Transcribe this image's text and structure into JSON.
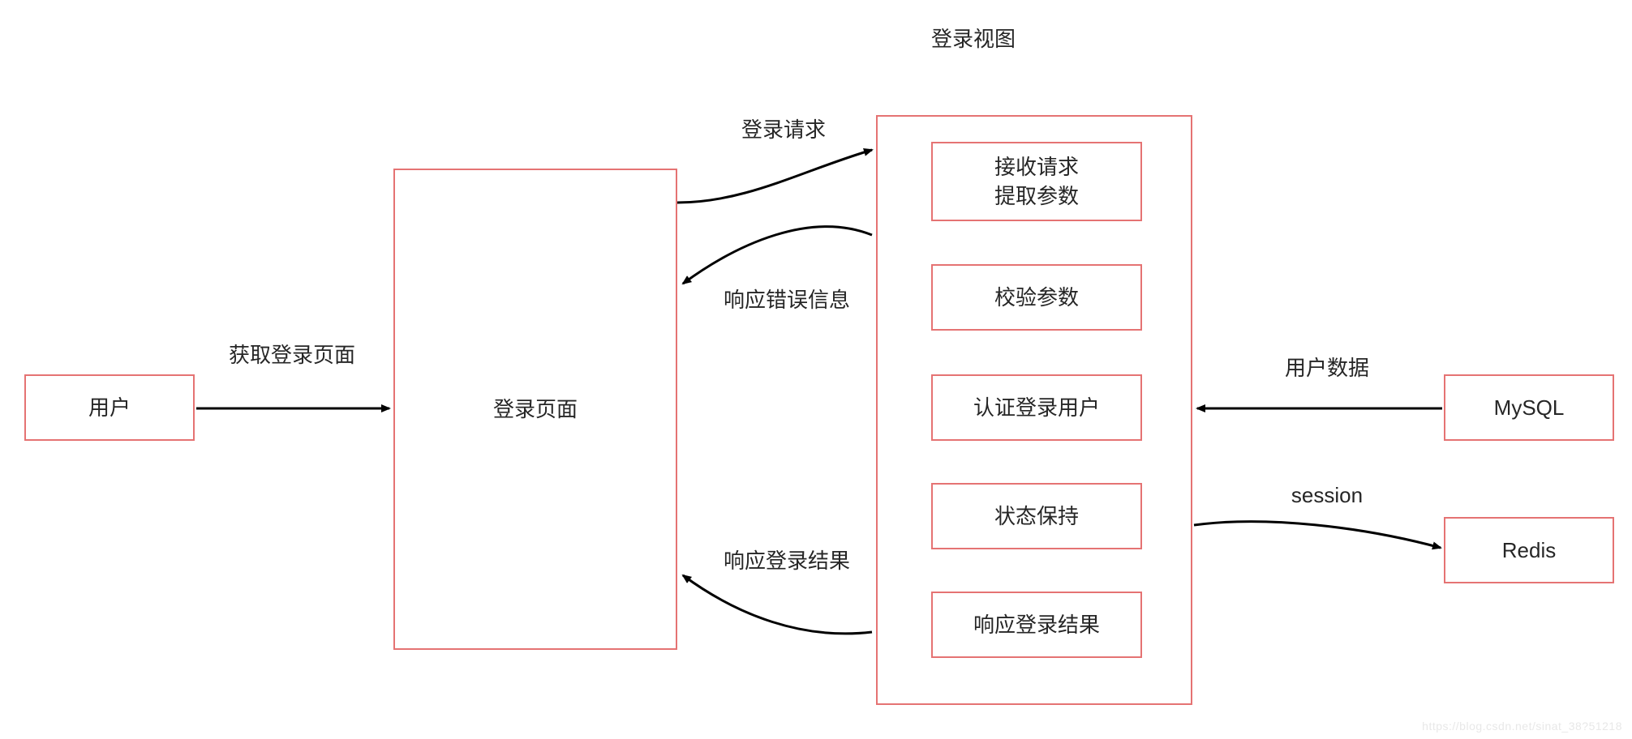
{
  "title": "登录视图",
  "nodes": {
    "user": "用户",
    "login_page": "登录页面",
    "step_receive": "接收请求\n提取参数",
    "step_validate": "校验参数",
    "step_auth": "认证登录用户",
    "step_state": "状态保持",
    "step_response": "响应登录结果",
    "mysql": "MySQL",
    "redis": "Redis"
  },
  "edges": {
    "get_login_page": "获取登录页面",
    "login_request": "登录请求",
    "resp_error": "响应错误信息",
    "resp_result": "响应登录结果",
    "user_data": "用户数据",
    "session": "session"
  },
  "watermark": "https://blog.csdn.net/sinat_38?51218"
}
